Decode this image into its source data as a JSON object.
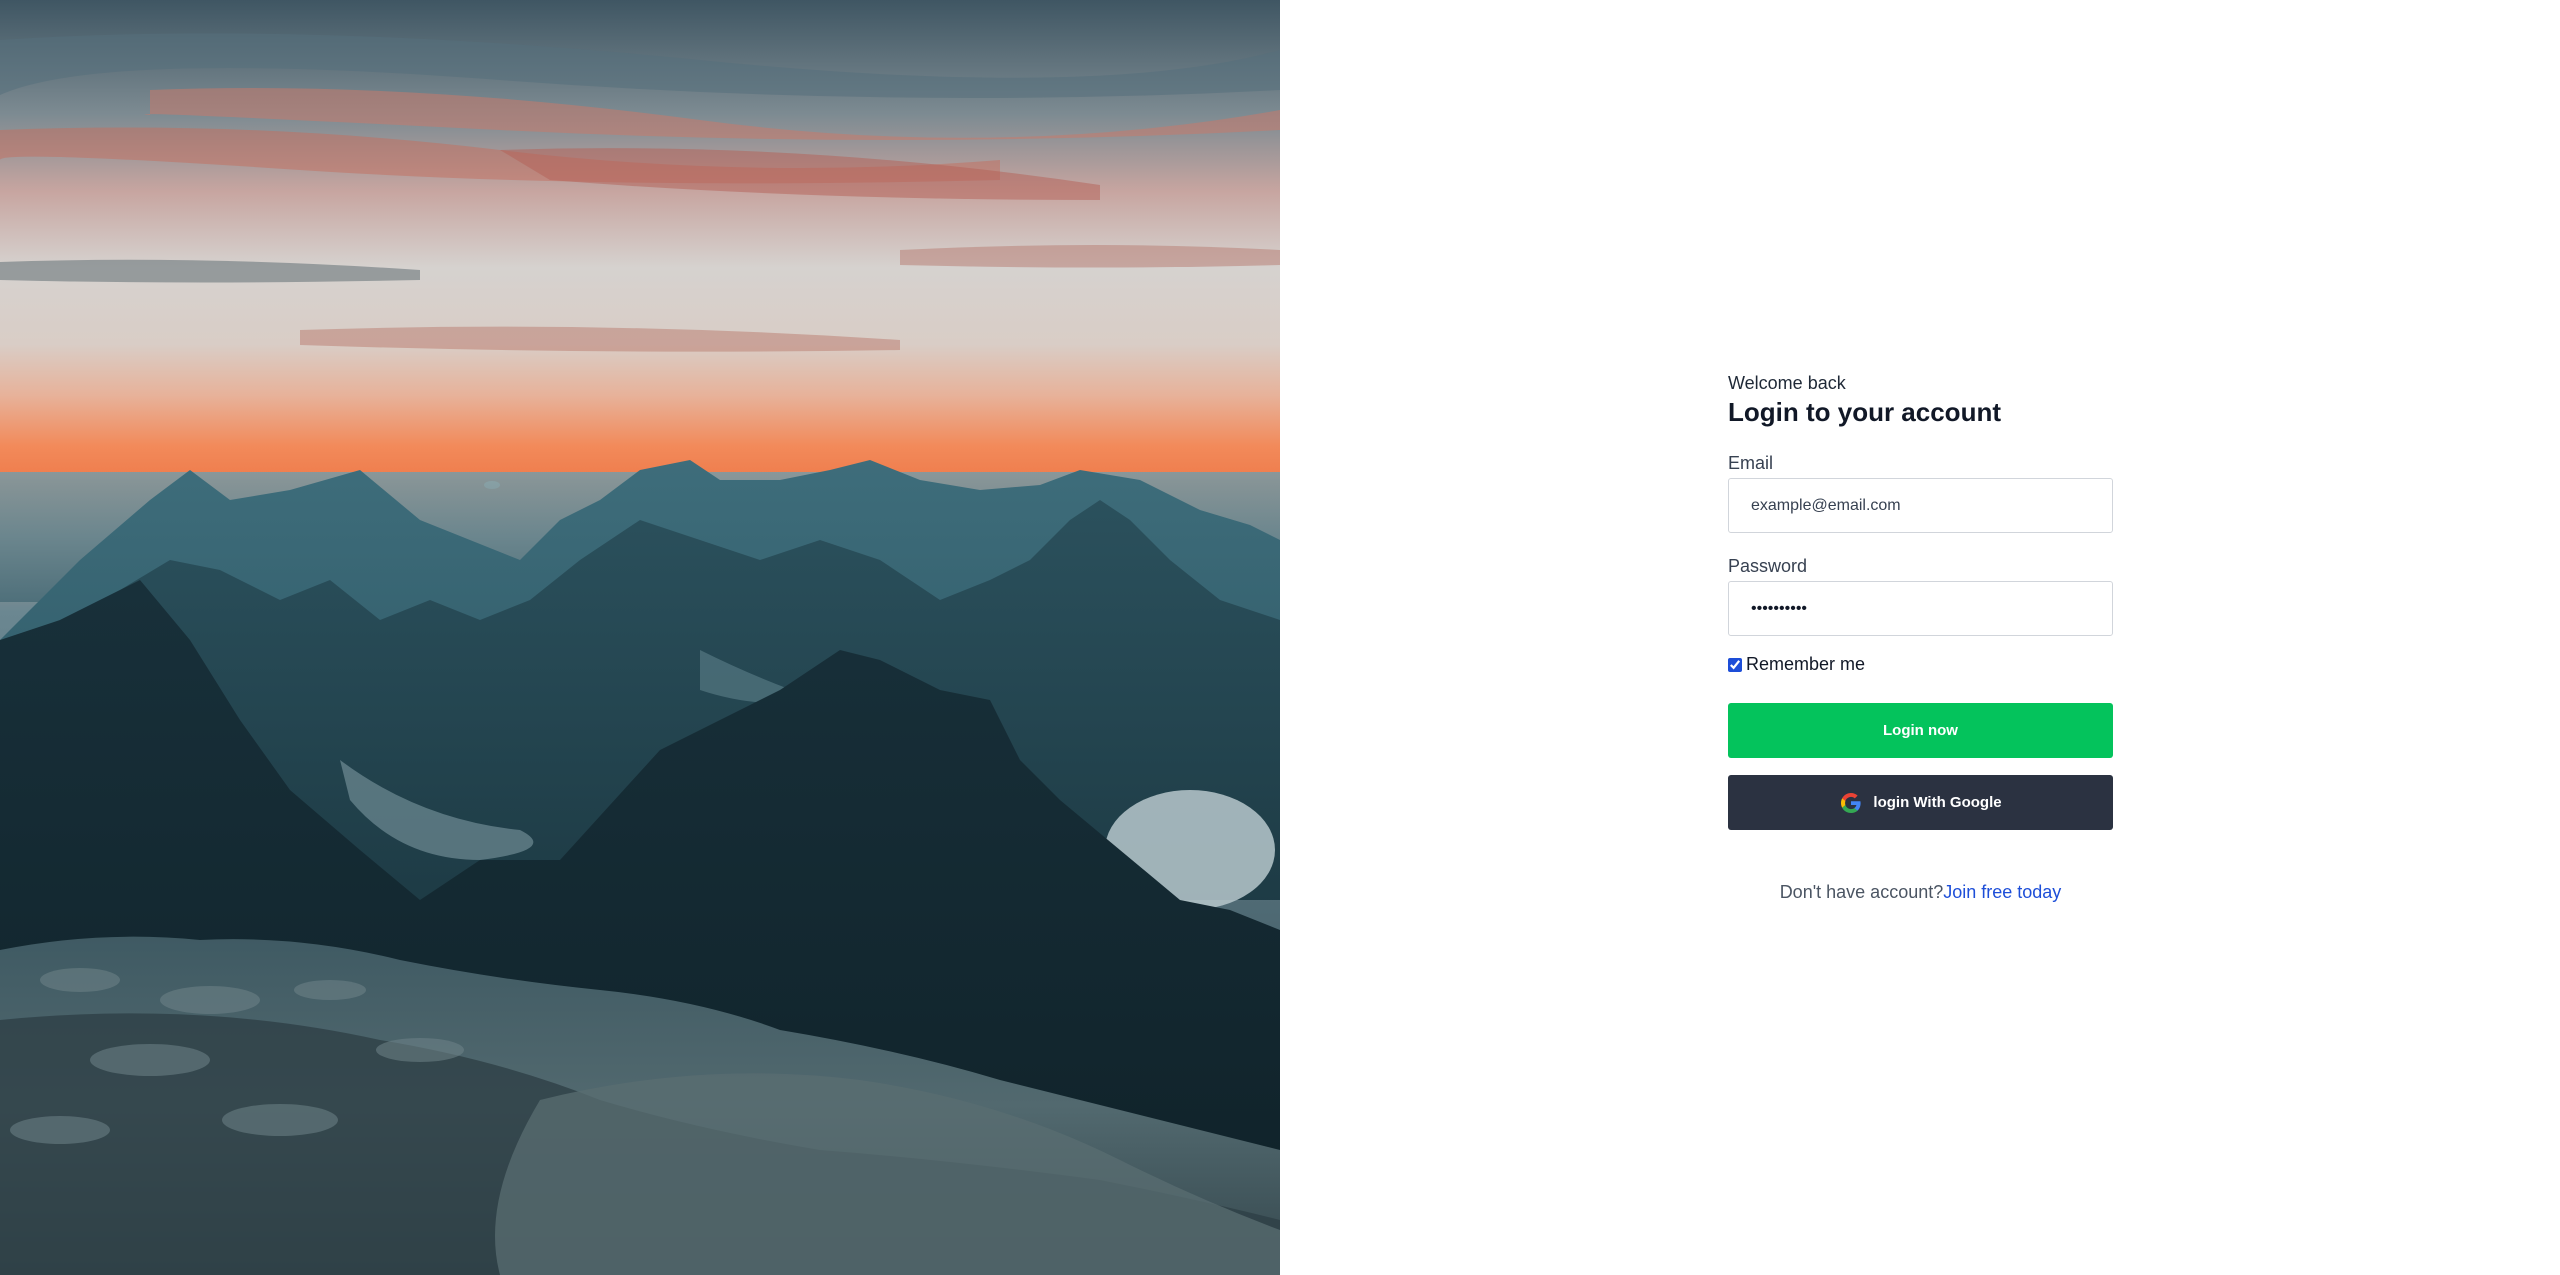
{
  "hero": {
    "image_description_icon": "mountain-sunset-photo"
  },
  "form": {
    "welcome": "Welcome back",
    "title": "Login to your account",
    "email_label": "Email",
    "email_placeholder": "example@email.com",
    "password_label": "Password",
    "password_value": "••••••••••",
    "remember_label": "Remember me",
    "remember_checked": true,
    "login_button": "Login now",
    "google_button": "login With Google",
    "signup_prompt": "Don't have account?",
    "signup_link": "Join free today"
  },
  "colors": {
    "primary_green": "#04c35c",
    "google_button_bg": "#2b3241",
    "link_blue": "#1d4ed8"
  }
}
